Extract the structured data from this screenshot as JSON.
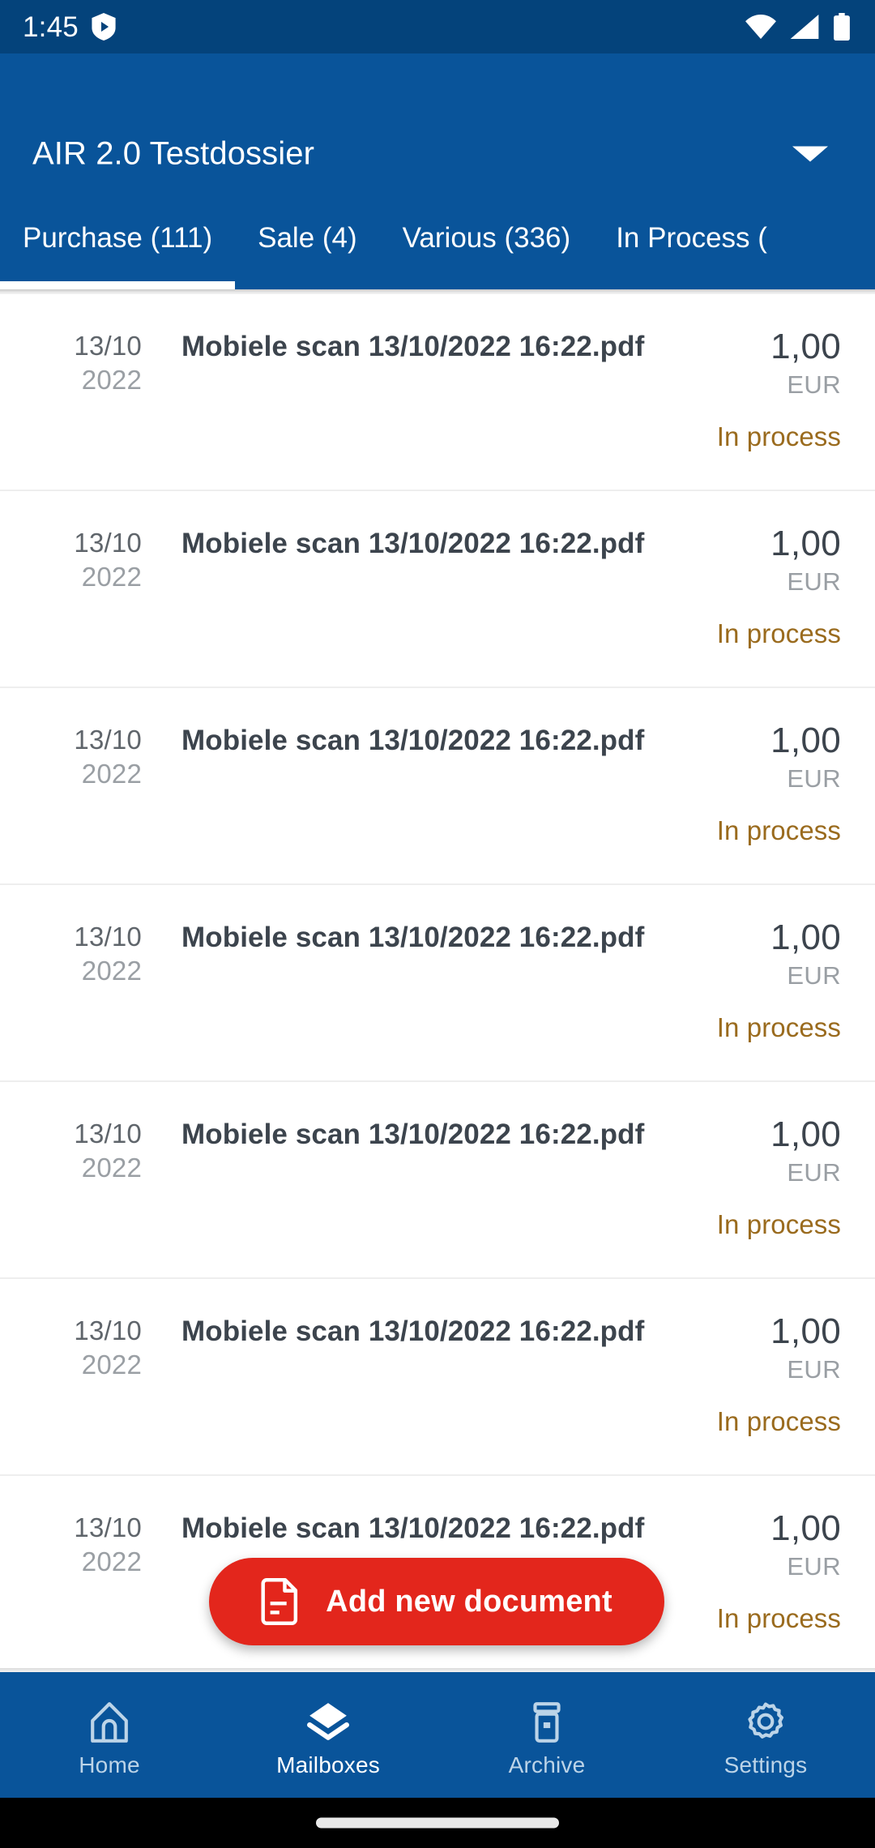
{
  "status_bar": {
    "clock": "1:45",
    "icons": [
      "play-shield-icon",
      "wifi-icon",
      "signal-icon",
      "battery-icon"
    ],
    "background_color": "#04437B"
  },
  "app_bar": {
    "title": "AIR 2.0 Testdossier",
    "dropdown_icon": "chevron-down-icon",
    "background_color": "#09549A"
  },
  "tabs": {
    "active_index": 0,
    "items": [
      {
        "label": "Purchase (111)"
      },
      {
        "label": "Sale (4)"
      },
      {
        "label": "Various (336)"
      },
      {
        "label": "In Process ("
      }
    ]
  },
  "documents": {
    "rows": [
      {
        "day": "13/10",
        "year": "2022",
        "title": "Mobiele scan 13/10/2022 16:22.pdf",
        "amount": "1,00",
        "currency": "EUR",
        "status": "In process"
      },
      {
        "day": "13/10",
        "year": "2022",
        "title": "Mobiele scan 13/10/2022 16:22.pdf",
        "amount": "1,00",
        "currency": "EUR",
        "status": "In process"
      },
      {
        "day": "13/10",
        "year": "2022",
        "title": "Mobiele scan 13/10/2022 16:22.pdf",
        "amount": "1,00",
        "currency": "EUR",
        "status": "In process"
      },
      {
        "day": "13/10",
        "year": "2022",
        "title": "Mobiele scan 13/10/2022 16:22.pdf",
        "amount": "1,00",
        "currency": "EUR",
        "status": "In process"
      },
      {
        "day": "13/10",
        "year": "2022",
        "title": "Mobiele scan 13/10/2022 16:22.pdf",
        "amount": "1,00",
        "currency": "EUR",
        "status": "In process"
      },
      {
        "day": "13/10",
        "year": "2022",
        "title": "Mobiele scan 13/10/2022 16:22.pdf",
        "amount": "1,00",
        "currency": "EUR",
        "status": "In process"
      },
      {
        "day": "13/10",
        "year": "2022",
        "title": "Mobiele scan 13/10/2022 16:22.pdf",
        "amount": "1,00",
        "currency": "EUR",
        "status": "In process"
      }
    ],
    "status_color": "#9A6B1E"
  },
  "fab": {
    "label": "Add new document",
    "icon": "document-lines-icon",
    "background_color": "#E3261C"
  },
  "bottom_nav": {
    "active_index": 1,
    "items": [
      {
        "label": "Home",
        "icon": "home-icon"
      },
      {
        "label": "Mailboxes",
        "icon": "layers-icon"
      },
      {
        "label": "Archive",
        "icon": "archive-box-icon"
      },
      {
        "label": "Settings",
        "icon": "gear-icon"
      }
    ]
  },
  "gesture_bar": {
    "icon": "home-pill-indicator"
  }
}
